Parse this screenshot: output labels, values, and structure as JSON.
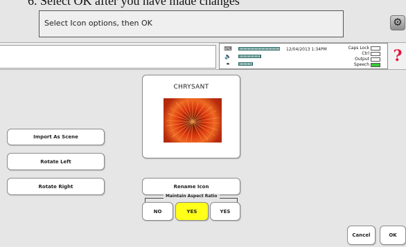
{
  "heading": {
    "text": "6. Select OK after you have made changes"
  },
  "instruction": {
    "text": "Select Icon options, then OK"
  },
  "icons": {
    "tools": "wrench-icon",
    "help": "help-icon",
    "speaker": "speaker-icon",
    "headphones": "headphones-icon",
    "keyboard": "keyboard-icon"
  },
  "status": {
    "datetime": "12/04/2013 1:34PM",
    "meters": [
      {
        "icon": "keyboard-icon",
        "level": 1.0
      },
      {
        "icon": "speaker-icon",
        "level": 0.55
      },
      {
        "icon": "headphones-icon",
        "level": 0.35
      }
    ],
    "locks": [
      {
        "label": "Caps Lock",
        "on": false
      },
      {
        "label": "Ctrl",
        "on": false
      },
      {
        "label": "Output",
        "on": false
      },
      {
        "label": "Speech",
        "on": true
      }
    ]
  },
  "preview": {
    "title": "CHRYSANT"
  },
  "buttons": {
    "import_scene": "Import As Scene",
    "rotate_left": "Rotate Left",
    "rotate_right": "Rotate Right",
    "rename_icon": "Rename Icon",
    "cancel": "Cancel",
    "ok": "OK"
  },
  "aspect_ratio": {
    "label": "Maintain Aspect Ratio",
    "options": [
      "NO",
      "YES",
      "YES"
    ],
    "selected_index": 1
  },
  "colors": {
    "selected_option": "#ffff19",
    "help_accent": "#e0143c",
    "speech_on": "#38c838"
  }
}
